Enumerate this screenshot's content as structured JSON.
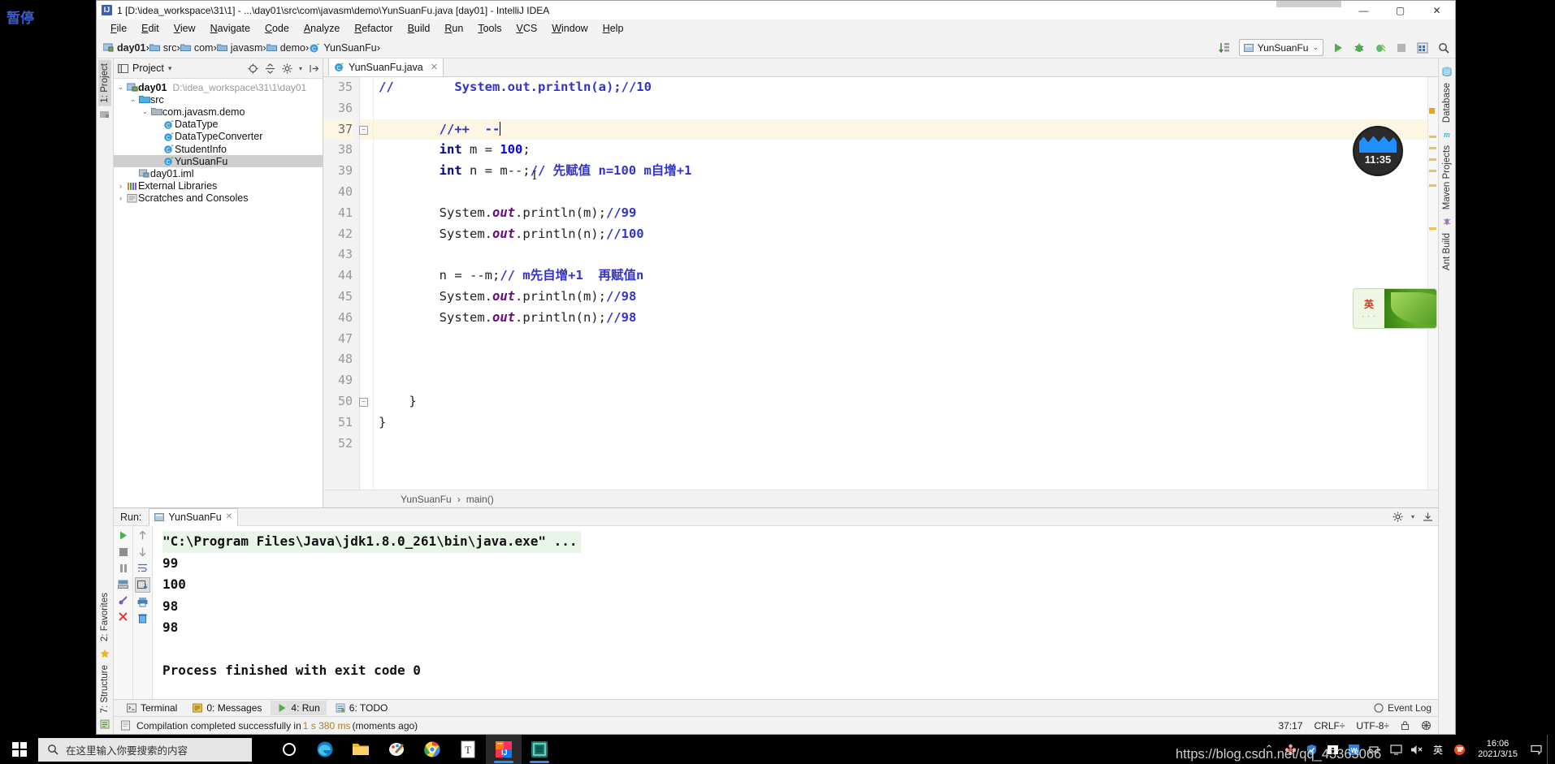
{
  "desktop": {
    "left_label": "暂停",
    "clock_widget": {
      "time": "11:35"
    },
    "ime_widget": {
      "mode": "英",
      "dots": "· · ·"
    },
    "watermark": "https://blog.csdn.net/qq_43363066"
  },
  "window": {
    "title": "1 [D:\\idea_workspace\\31\\1] - ...\\day01\\src\\com\\javasm\\demo\\YunSuanFu.java [day01] - IntelliJ IDEA",
    "minimize": "—",
    "maximize": "▢",
    "close": "✕"
  },
  "menubar": {
    "items": [
      "File",
      "Edit",
      "View",
      "Navigate",
      "Code",
      "Analyze",
      "Refactor",
      "Build",
      "Run",
      "Tools",
      "VCS",
      "Window",
      "Help"
    ]
  },
  "navbar": {
    "crumbs": [
      {
        "label": "day01",
        "icon": "module-icon"
      },
      {
        "label": "src",
        "icon": "folder-icon"
      },
      {
        "label": "com",
        "icon": "folder-icon"
      },
      {
        "label": "javasm",
        "icon": "folder-icon"
      },
      {
        "label": "demo",
        "icon": "folder-icon"
      },
      {
        "label": "YunSuanFu",
        "icon": "class-icon"
      }
    ],
    "separator": "›",
    "run_config": "YunSuanFu",
    "run_config_caret": "⌄"
  },
  "left_strip": {
    "project_tab": "1: Project",
    "favorites_tab": "2: Favorites",
    "structure_tab": "7: Structure"
  },
  "right_strip": {
    "database_tab": "Database",
    "maven_tab": "Maven Projects",
    "ant_tab": "Ant Build"
  },
  "project_tool": {
    "title": "Project",
    "caret": "▾",
    "tree": [
      {
        "indent": 0,
        "arrow": "⌄",
        "icon": "module-icon",
        "label": "day01",
        "bold": true,
        "path": "D:\\idea_workspace\\31\\1\\day01",
        "selected": false
      },
      {
        "indent": 1,
        "arrow": "⌄",
        "icon": "folder-src-icon",
        "label": "src",
        "bold": false,
        "path": "",
        "selected": false
      },
      {
        "indent": 2,
        "arrow": "⌄",
        "icon": "package-icon",
        "label": "com.javasm.demo",
        "bold": false,
        "path": "",
        "selected": false
      },
      {
        "indent": 3,
        "arrow": "",
        "icon": "class-icon",
        "label": "DataType",
        "bold": false,
        "path": "",
        "selected": false
      },
      {
        "indent": 3,
        "arrow": "",
        "icon": "class-icon",
        "label": "DataTypeConverter",
        "bold": false,
        "path": "",
        "selected": false
      },
      {
        "indent": 3,
        "arrow": "",
        "icon": "class-icon",
        "label": "StudentInfo",
        "bold": false,
        "path": "",
        "selected": false
      },
      {
        "indent": 3,
        "arrow": "",
        "icon": "class-icon",
        "label": "YunSuanFu",
        "bold": false,
        "path": "",
        "selected": true
      },
      {
        "indent": 1,
        "arrow": "",
        "icon": "iml-icon",
        "label": "day01.iml",
        "bold": false,
        "path": "",
        "selected": false
      },
      {
        "indent": 0,
        "arrow": "›",
        "icon": "library-icon",
        "label": "External Libraries",
        "bold": false,
        "path": "",
        "selected": false
      },
      {
        "indent": 0,
        "arrow": "›",
        "icon": "scratch-icon",
        "label": "Scratches and Consoles",
        "bold": false,
        "path": "",
        "selected": false
      }
    ]
  },
  "editor": {
    "tab": {
      "label": "YunSuanFu.java",
      "close": "✕"
    },
    "first_line_number": 35,
    "current_line": 37,
    "lines": [
      {
        "n": 35,
        "tokens": [
          {
            "t": "//        ",
            "c": "cmt"
          },
          {
            "t": "System.out.println(a);//10",
            "c": "cmt"
          }
        ]
      },
      {
        "n": 36,
        "tokens": []
      },
      {
        "n": 37,
        "tokens": [
          {
            "t": "        //++  --",
            "c": "cmt"
          }
        ]
      },
      {
        "n": 38,
        "tokens": [
          {
            "t": "        ",
            "c": "pl"
          },
          {
            "t": "int",
            "c": "kw"
          },
          {
            "t": " m = ",
            "c": "pl"
          },
          {
            "t": "100",
            "c": "num"
          },
          {
            "t": ";",
            "c": "pl"
          }
        ]
      },
      {
        "n": 39,
        "tokens": [
          {
            "t": "        ",
            "c": "pl"
          },
          {
            "t": "int",
            "c": "kw"
          },
          {
            "t": " n = m--;",
            "c": "pl"
          },
          {
            "t": "// 先赋值 n=100 m自增+1",
            "c": "cmt"
          }
        ]
      },
      {
        "n": 40,
        "tokens": []
      },
      {
        "n": 41,
        "tokens": [
          {
            "t": "        System.",
            "c": "pl"
          },
          {
            "t": "out",
            "c": "fld"
          },
          {
            "t": ".println(m);",
            "c": "pl"
          },
          {
            "t": "//99",
            "c": "cmt"
          }
        ]
      },
      {
        "n": 42,
        "tokens": [
          {
            "t": "        System.",
            "c": "pl"
          },
          {
            "t": "out",
            "c": "fld"
          },
          {
            "t": ".println(n);",
            "c": "pl"
          },
          {
            "t": "//100",
            "c": "cmt"
          }
        ]
      },
      {
        "n": 43,
        "tokens": []
      },
      {
        "n": 44,
        "tokens": [
          {
            "t": "        n = --m;",
            "c": "pl"
          },
          {
            "t": "// m先自增+1  再赋值n",
            "c": "cmt"
          }
        ]
      },
      {
        "n": 45,
        "tokens": [
          {
            "t": "        System.",
            "c": "pl"
          },
          {
            "t": "out",
            "c": "fld"
          },
          {
            "t": ".println(m);",
            "c": "pl"
          },
          {
            "t": "//98",
            "c": "cmt"
          }
        ]
      },
      {
        "n": 46,
        "tokens": [
          {
            "t": "        System.",
            "c": "pl"
          },
          {
            "t": "out",
            "c": "fld"
          },
          {
            "t": ".println(n);",
            "c": "pl"
          },
          {
            "t": "//98",
            "c": "cmt"
          }
        ]
      },
      {
        "n": 47,
        "tokens": []
      },
      {
        "n": 48,
        "tokens": []
      },
      {
        "n": 49,
        "tokens": []
      },
      {
        "n": 50,
        "tokens": [
          {
            "t": "    }",
            "c": "pl"
          }
        ]
      },
      {
        "n": 51,
        "tokens": [
          {
            "t": "}",
            "c": "pl"
          }
        ]
      },
      {
        "n": 52,
        "tokens": []
      }
    ],
    "bottom_breadcrumb": [
      "YunSuanFu",
      "main()"
    ],
    "bottom_breadcrumb_sep": "›"
  },
  "run_tool": {
    "label": "Run:",
    "tab": "YunSuanFu",
    "tab_close": "✕",
    "console": [
      {
        "text": "\"C:\\Program Files\\Java\\jdk1.8.0_261\\bin\\java.exe\" ...",
        "style": "cmdline"
      },
      {
        "text": "99",
        "style": ""
      },
      {
        "text": "100",
        "style": ""
      },
      {
        "text": "98",
        "style": ""
      },
      {
        "text": "98",
        "style": ""
      },
      {
        "text": "",
        "style": ""
      },
      {
        "text": "Process finished with exit code 0",
        "style": ""
      }
    ]
  },
  "bottom_toolbar": {
    "buttons": [
      {
        "label": "Terminal",
        "icon": "terminal-icon",
        "active": false
      },
      {
        "label": "0: Messages",
        "icon": "messages-icon",
        "active": false
      },
      {
        "label": "4: Run",
        "icon": "run-icon",
        "active": true
      },
      {
        "label": "6: TODO",
        "icon": "todo-icon",
        "active": false
      }
    ],
    "event_log": "Event Log"
  },
  "statusbar": {
    "message_prefix": "Compilation completed successfully in ",
    "message_time": "1 s 380 ms",
    "message_suffix": " (moments ago)",
    "caret_position": "37:17",
    "line_separator": "CRLF÷",
    "encoding": "UTF-8÷"
  },
  "taskbar": {
    "search_placeholder": "在这里输入你要搜索的内容",
    "apps": [
      {
        "name": "cortana-icon"
      },
      {
        "name": "edge-icon"
      },
      {
        "name": "file-explorer-icon"
      },
      {
        "name": "paint-icon"
      },
      {
        "name": "chrome-icon"
      },
      {
        "name": "typora-icon"
      },
      {
        "name": "intellij-idea-icon"
      },
      {
        "name": "navicat-icon"
      }
    ],
    "tray": {
      "expand": "⌃",
      "ime_label": "英",
      "time": "16:06",
      "date": "2021/3/15"
    }
  }
}
